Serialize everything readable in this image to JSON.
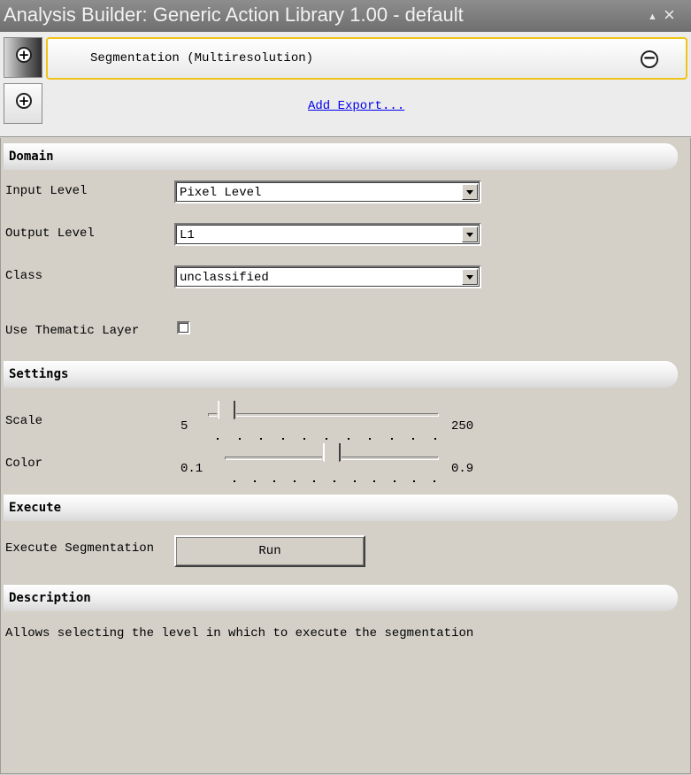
{
  "window": {
    "title": "Analysis Builder: Generic Action Library 1.00 - default",
    "minimize_glyph": "▲",
    "close_glyph": "×"
  },
  "actions": {
    "segmentation_label": "Segmentation (Multiresolution)",
    "add_export_label": "Add Export...",
    "plus_glyph": "+",
    "minus_glyph": "−"
  },
  "domain": {
    "header": "Domain",
    "input_level": {
      "label": "Input Level",
      "value": "Pixel Level"
    },
    "output_level": {
      "label": "Output Level",
      "value": "L1"
    },
    "class": {
      "label": "Class",
      "value": "unclassified"
    },
    "use_thematic_layer": {
      "label": "Use Thematic Layer",
      "checked": false
    }
  },
  "settings": {
    "header": "Settings",
    "scale": {
      "label": "Scale",
      "min": "5",
      "max": "250",
      "value": 25
    },
    "color": {
      "label": "Color",
      "min": "0.1",
      "max": "0.9",
      "value": 0.5
    }
  },
  "execute": {
    "header": "Execute",
    "label": "Execute Segmentation",
    "button": "Run"
  },
  "description": {
    "header": "Description",
    "text": "Allows selecting the level in which to execute the segmentation"
  }
}
